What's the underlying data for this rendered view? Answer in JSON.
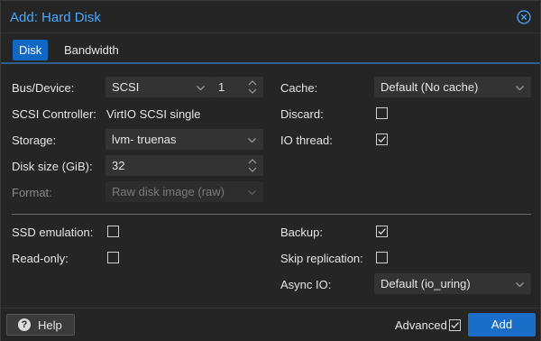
{
  "dialog": {
    "title": "Add: Hard Disk"
  },
  "tabs": [
    {
      "label": "Disk",
      "active": true
    },
    {
      "label": "Bandwidth",
      "active": false
    }
  ],
  "left": {
    "bus_device": {
      "label": "Bus/Device:",
      "bus": "SCSI",
      "device": "1"
    },
    "scsi_controller": {
      "label": "SCSI Controller:",
      "value": "VirtIO SCSI single"
    },
    "storage": {
      "label": "Storage:",
      "value_prefix": "lvm-",
      "value": "truenas"
    },
    "disk_size": {
      "label": "Disk size (GiB):",
      "value": "32"
    },
    "format": {
      "label": "Format:",
      "value": "Raw disk image (raw)"
    }
  },
  "right": {
    "cache": {
      "label": "Cache:",
      "value": "Default (No cache)"
    },
    "discard": {
      "label": "Discard:",
      "checked": false
    },
    "io_thread": {
      "label": "IO thread:",
      "checked": true
    }
  },
  "advanced": {
    "ssd_emulation": {
      "label": "SSD emulation:",
      "checked": false
    },
    "read_only": {
      "label": "Read-only:",
      "checked": false
    },
    "backup": {
      "label": "Backup:",
      "checked": true
    },
    "skip_replication": {
      "label": "Skip replication:",
      "checked": false
    },
    "async_io": {
      "label": "Async IO:",
      "value": "Default (io_uring)"
    }
  },
  "footer": {
    "help_label": "Help",
    "advanced_label": "Advanced",
    "advanced_checked": true,
    "add_label": "Add"
  },
  "colors": {
    "accent": "#1a6ec7",
    "title": "#4aa8ff",
    "background": "#252526",
    "field": "#333333"
  },
  "icons": {
    "close": "close-circle-icon",
    "help": "question-circle-icon",
    "dropdown": "chevron-down-icon",
    "spinner": "spinner-arrows-icon",
    "check": "checkmark-icon"
  }
}
